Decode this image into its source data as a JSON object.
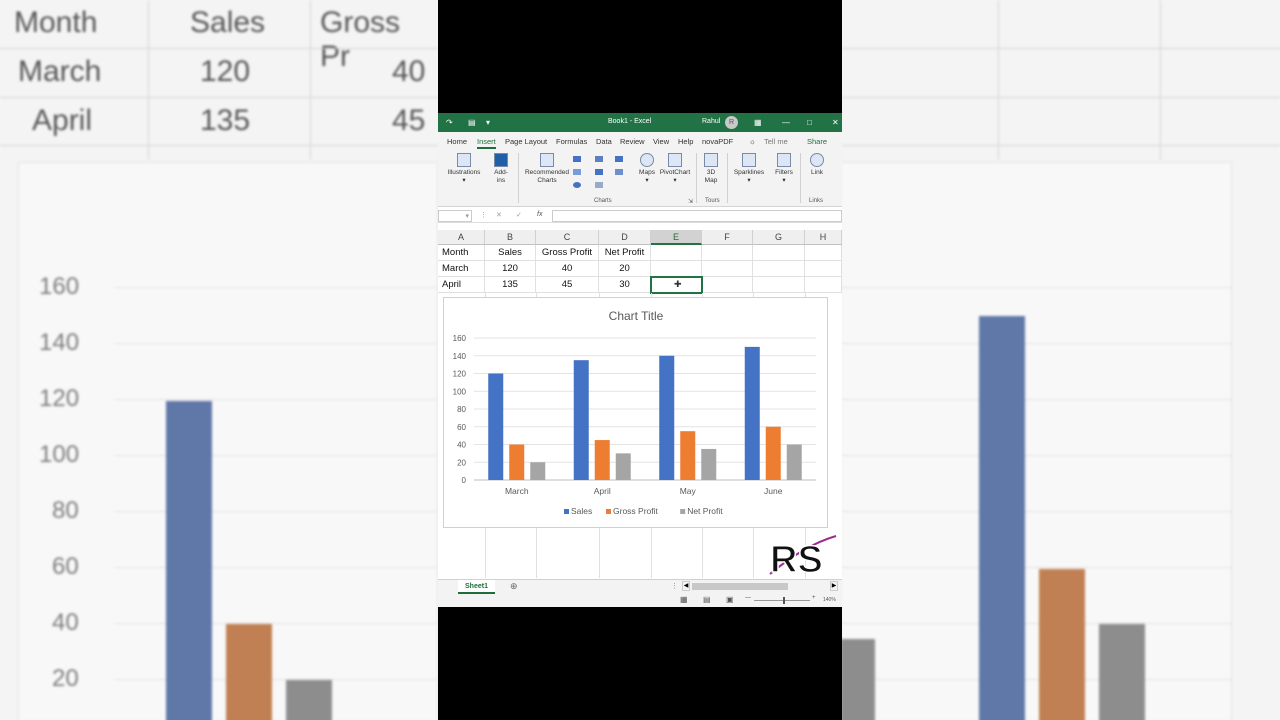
{
  "window": {
    "title": "Book1 - Excel",
    "user": "Rahul",
    "user_initial": "R"
  },
  "tabs": [
    "Home",
    "Insert",
    "Page Layout",
    "Formulas",
    "Data",
    "Review",
    "View",
    "Help",
    "novaPDF"
  ],
  "active_tab": "Insert",
  "tell_me": "Tell me",
  "share": "Share",
  "ribbon": {
    "illustrations": "Illustrations",
    "addins_1": "Add-",
    "addins_2": "ins",
    "recommended_1": "Recommended",
    "recommended_2": "Charts",
    "maps": "Maps",
    "pivotchart": "PivotChart",
    "map3d_1": "3D",
    "map3d_2": "Map",
    "sparklines": "Sparklines",
    "filters": "Filters",
    "link": "Link",
    "group_charts": "Charts",
    "group_tours": "Tours",
    "group_links": "Links"
  },
  "formula_bar": {
    "fx": "fx"
  },
  "columns": [
    "A",
    "B",
    "C",
    "D",
    "E",
    "F",
    "G",
    "H"
  ],
  "selected_column": "E",
  "table": {
    "headers": [
      "Month",
      "Sales",
      "Gross Profit",
      "Net Profit"
    ],
    "rows": [
      [
        "March",
        "120",
        "40",
        "20"
      ],
      [
        "April",
        "135",
        "45",
        "30"
      ]
    ]
  },
  "sheet": {
    "name": "Sheet1",
    "zoom": "140%"
  },
  "chart_data": {
    "type": "bar",
    "title": "Chart Title",
    "categories": [
      "March",
      "April",
      "May",
      "June"
    ],
    "series": [
      {
        "name": "Sales",
        "values": [
          120,
          135,
          140,
          150
        ],
        "color": "#4472c4"
      },
      {
        "name": "Gross Profit",
        "values": [
          40,
          45,
          55,
          60
        ],
        "color": "#ed7d31"
      },
      {
        "name": "Net Profit",
        "values": [
          20,
          30,
          35,
          40
        ],
        "color": "#a5a5a5"
      }
    ],
    "ylim": [
      0,
      160
    ],
    "yticks": [
      "0",
      "20",
      "40",
      "60",
      "80",
      "100",
      "120",
      "140",
      "160"
    ],
    "grid": true,
    "legend": "bottom"
  },
  "background": {
    "headers": [
      "Month",
      "Sales",
      "Gross Pr"
    ],
    "row1": [
      "March",
      "120",
      "40"
    ],
    "row2": [
      "April",
      "135",
      "45"
    ],
    "yticks": [
      "160",
      "140",
      "120",
      "100",
      "80",
      "60",
      "40",
      "20"
    ]
  },
  "colors": {
    "excel_green": "#217346",
    "accent_text": "#1e6e3c"
  }
}
